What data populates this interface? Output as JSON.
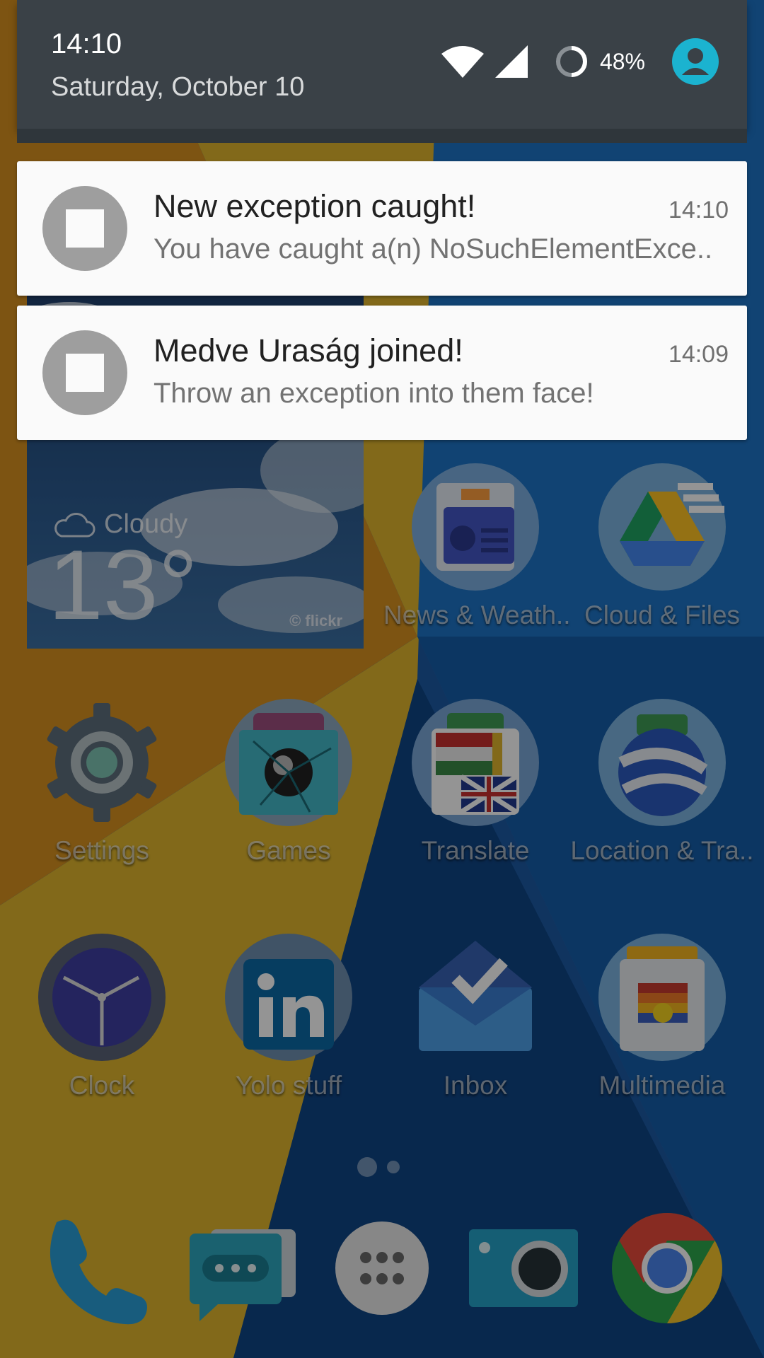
{
  "status_bar": {
    "time": "14:10",
    "date": "Saturday, October 10",
    "battery": "48%",
    "icons": [
      "wifi-icon",
      "cell-signal-icon",
      "battery-icon",
      "user-avatar-icon"
    ]
  },
  "notifications": [
    {
      "title": "New exception caught!",
      "text": "You have caught a(n) NoSuchElementExce..",
      "time": "14:10",
      "icon": "app-square-icon"
    },
    {
      "title": "Medve Uraság joined!",
      "text": "Throw an exception into them face!",
      "time": "14:09",
      "icon": "app-square-icon"
    }
  ],
  "weather_widget": {
    "condition": "Cloudy",
    "temperature": "13°",
    "credit": "© flickr"
  },
  "home_apps": [
    {
      "label": "News & Weath..",
      "icon": "news-icon"
    },
    {
      "label": "Cloud & Files",
      "icon": "drive-icon"
    },
    {
      "label": "Settings",
      "icon": "gear-icon"
    },
    {
      "label": "Games",
      "icon": "games-icon"
    },
    {
      "label": "Translate",
      "icon": "flags-icon"
    },
    {
      "label": "Location & Tra..",
      "icon": "globe-icon"
    },
    {
      "label": "Clock",
      "icon": "clock-icon"
    },
    {
      "label": "Yolo stuff",
      "icon": "linkedin-icon"
    },
    {
      "label": "Inbox",
      "icon": "inbox-icon"
    },
    {
      "label": "Multimedia",
      "icon": "multimedia-icon"
    }
  ],
  "dock": [
    "phone-icon",
    "messaging-icon",
    "app-drawer-icon",
    "camera-icon",
    "chrome-icon"
  ],
  "colors": {
    "header_bg": "#3a4147",
    "notification_bg": "#fafafa",
    "accent_avatar": "#1bb3d0",
    "wallpaper_yellow": "#c9a526",
    "wallpaper_blue": "#1764b2"
  }
}
